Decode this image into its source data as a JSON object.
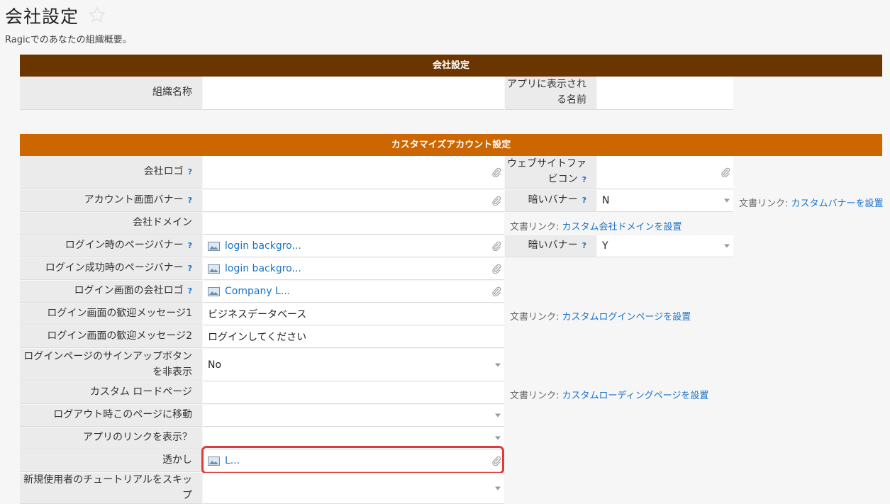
{
  "page": {
    "title": "会社設定",
    "subtitle": "Ragicでのあなたの組織概要。"
  },
  "section1": {
    "header": "会社設定",
    "org_name_label": "組織名称",
    "app_name_label": "アプリに表示される名前",
    "org_name_value": "",
    "app_name_value": ""
  },
  "section2": {
    "header": "カスタマイズアカウント設定",
    "help_mark": "?",
    "doc_prefix": "文書リンク:",
    "rows": {
      "company_logo": {
        "label": "会社ロゴ",
        "value": ""
      },
      "favicon": {
        "label": "ウェブサイトファビコン",
        "value": ""
      },
      "account_banner": {
        "label": "アカウント画面バナー",
        "value": ""
      },
      "dark_banner1": {
        "label": "暗いバナー",
        "value": "N"
      },
      "company_domain": {
        "label": "会社ドメイン",
        "value": ""
      },
      "login_banner": {
        "label": "ログイン時のページバナー",
        "value": "login backgro..."
      },
      "dark_banner2": {
        "label": "暗いバナー",
        "value": "Y"
      },
      "login_success_banner": {
        "label": "ログイン成功時のページバナー",
        "value": "login backgro..."
      },
      "login_company_logo": {
        "label": "ログイン画面の会社ロゴ",
        "value": "Company L..."
      },
      "welcome1": {
        "label": "ログイン画面の歓迎メッセージ1",
        "value": "ビジネスデータベース"
      },
      "welcome2": {
        "label": "ログイン画面の歓迎メッセージ2",
        "value": "ログインしてください"
      },
      "hide_signup": {
        "label": "ログインページのサインアップボタンを非表示",
        "value": "No"
      },
      "custom_load_page": {
        "label": "カスタム ロードページ",
        "value": ""
      },
      "logout_redirect": {
        "label": "ログアウト時このページに移動",
        "value": ""
      },
      "show_app_link": {
        "label": "アプリのリンクを表示？",
        "value": ""
      },
      "watermark": {
        "label": "透かし",
        "value": "L..."
      },
      "skip_tutorial": {
        "label": "新規使用者のチュートリアルをスキップ",
        "value": ""
      }
    },
    "doclinks": {
      "banner": "カスタムバナーを設置",
      "domain": "カスタム会社ドメインを設置",
      "login": "カスタムログインページを設置",
      "loading": "カスタムローディングページを設置"
    }
  },
  "colors": {
    "header_brown": "#6b3500",
    "header_orange": "#cc6600",
    "link_blue": "#1a73c8",
    "highlight_red": "#e03b3b"
  }
}
